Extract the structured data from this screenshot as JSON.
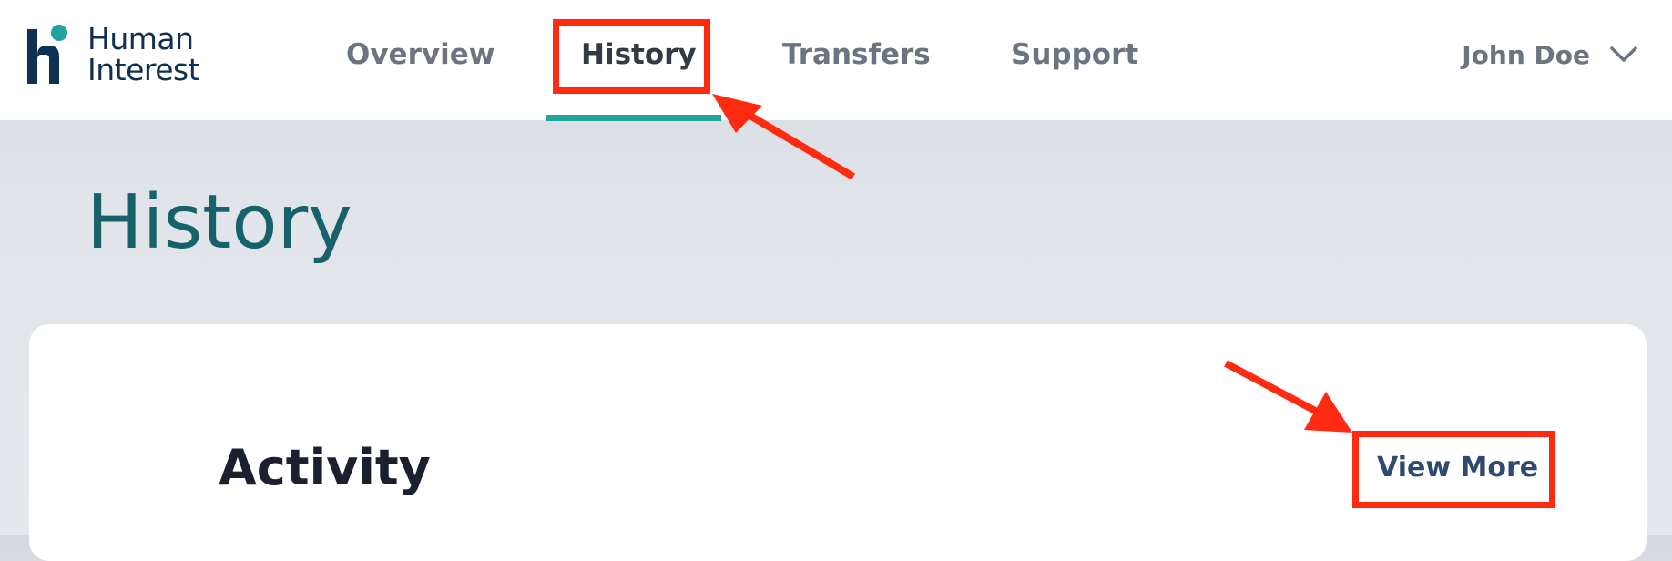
{
  "brand": {
    "line1": "Human",
    "line2": "Interest",
    "logo_icon": "human-interest-logo",
    "colors": {
      "navy": "#0f3050",
      "teal": "#20a49c"
    }
  },
  "nav": {
    "items": [
      {
        "label": "Overview",
        "active": false
      },
      {
        "label": "History",
        "active": true
      },
      {
        "label": "Transfers",
        "active": false
      },
      {
        "label": "Support",
        "active": false
      }
    ],
    "active_indicator_color": "#20a49c"
  },
  "user": {
    "name": "John Doe",
    "menu_icon": "chevron-down-icon"
  },
  "page": {
    "title": "History",
    "title_color": "#17626a"
  },
  "activity": {
    "title": "Activity",
    "view_more_label": "View More"
  },
  "annotations": {
    "color": "#ff2a12"
  }
}
